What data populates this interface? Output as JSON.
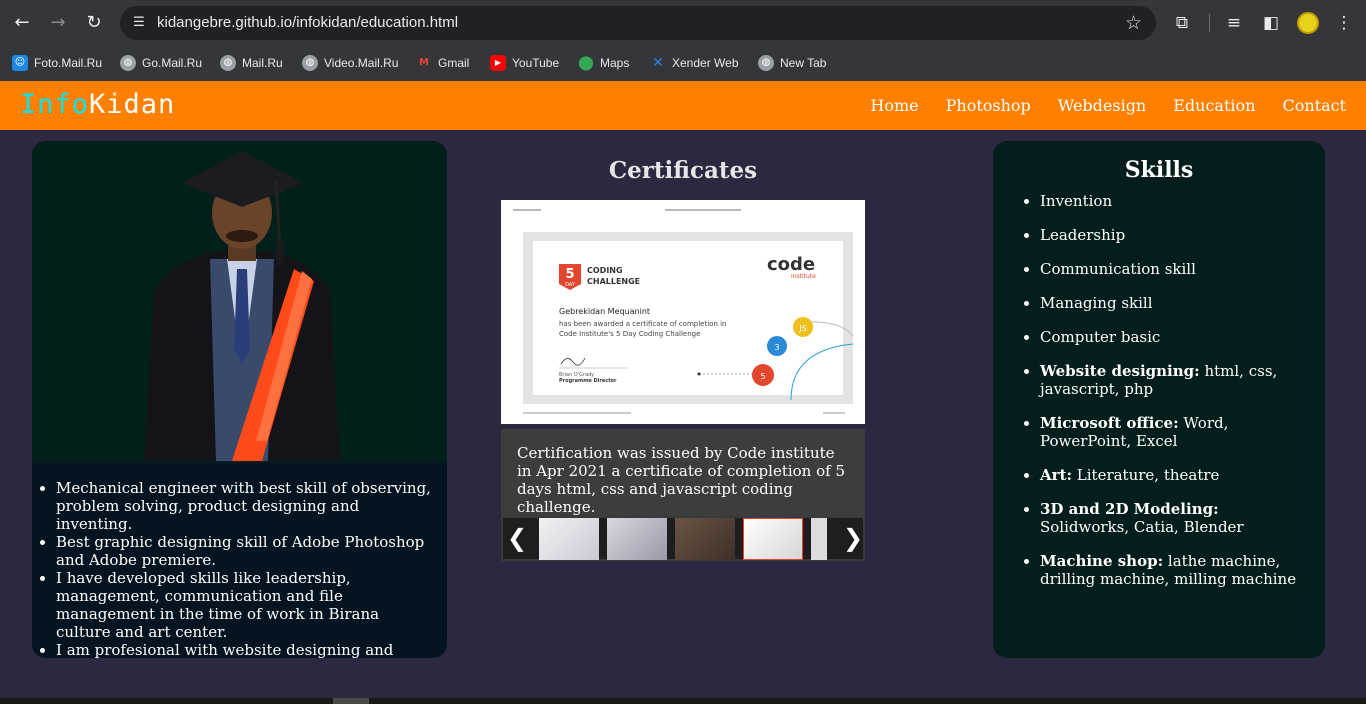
{
  "browser": {
    "url": "kidangebre.github.io/infokidan/education.html",
    "bookmarks": [
      {
        "label": "Foto.Mail.Ru",
        "icon": "photo-mail-icon",
        "color": "#1e88e5"
      },
      {
        "label": "Go.Mail.Ru",
        "icon": "globe-icon",
        "color": "#9aa0a6"
      },
      {
        "label": "Mail.Ru",
        "icon": "globe-icon",
        "color": "#9aa0a6"
      },
      {
        "label": "Video.Mail.Ru",
        "icon": "globe-icon",
        "color": "#9aa0a6"
      },
      {
        "label": "Gmail",
        "icon": "gmail-icon",
        "color": "#ea4335"
      },
      {
        "label": "YouTube",
        "icon": "youtube-icon",
        "color": "#ff0000"
      },
      {
        "label": "Maps",
        "icon": "maps-icon",
        "color": "#34a853"
      },
      {
        "label": "Xender Web",
        "icon": "xender-icon",
        "color": "#2a7de1"
      },
      {
        "label": "New Tab",
        "icon": "globe-icon",
        "color": "#9aa0a6"
      }
    ]
  },
  "site": {
    "logo_part1": "Info",
    "logo_part2": "Kidan",
    "nav": [
      "Home",
      "Photoshop",
      "Webdesign",
      "Education",
      "Contact"
    ]
  },
  "bio": [
    "Mechanical engineer with best skill of observing, problem solving, product designing and inventing.",
    "Best graphic designing skill of Adobe Photoshop and Adobe premiere.",
    "I have developed skills like leadership, management, communication and file management in the time of work in Birana culture and art center.",
    "I am profesional with website designing and fullstack developing."
  ],
  "certificates": {
    "title": "Certificates",
    "caption": "Certification was issued by Code institute in Apr 2021 a certificate of completion of 5 days html, css and javascript coding challenge.",
    "cert": {
      "badge_number": "5",
      "badge_day": "DAY",
      "challenge_line1": "CODING",
      "challenge_line2": "CHALLENGE",
      "brand": "code",
      "brand_sub": "institute",
      "recipient": "Gebrekidan Mequanint",
      "line1": "has been awarded a certificate of completion in",
      "line2": "Code Institute's 5 Day Coding Challenge",
      "signer": "Brian O'Grady",
      "signer_title": "Programme Director"
    },
    "prev_label": "❮",
    "next_label": "❯"
  },
  "skills": {
    "title": "Skills",
    "items": [
      {
        "bold": "",
        "text": "Invention"
      },
      {
        "bold": "",
        "text": "Leadership"
      },
      {
        "bold": "",
        "text": "Communication skill"
      },
      {
        "bold": "",
        "text": "Managing skill"
      },
      {
        "bold": "",
        "text": "Computer basic"
      },
      {
        "bold": "Website designing:",
        "text": " html, css, javascript, php"
      },
      {
        "bold": "Microsoft office:",
        "text": " Word, PowerPoint, Excel"
      },
      {
        "bold": "Art:",
        "text": " Literature, theatre"
      },
      {
        "bold": "3D and 2D Modeling:",
        "text": " Solidworks, Catia, Blender"
      },
      {
        "bold": "Machine shop:",
        "text": " lathe machine, drilling machine, milling machine"
      }
    ]
  },
  "colors": {
    "header": "#ff8000",
    "logo_accent": "#00e6f0",
    "page_bg": "#2b283f",
    "card_bg": "#031e1c"
  }
}
